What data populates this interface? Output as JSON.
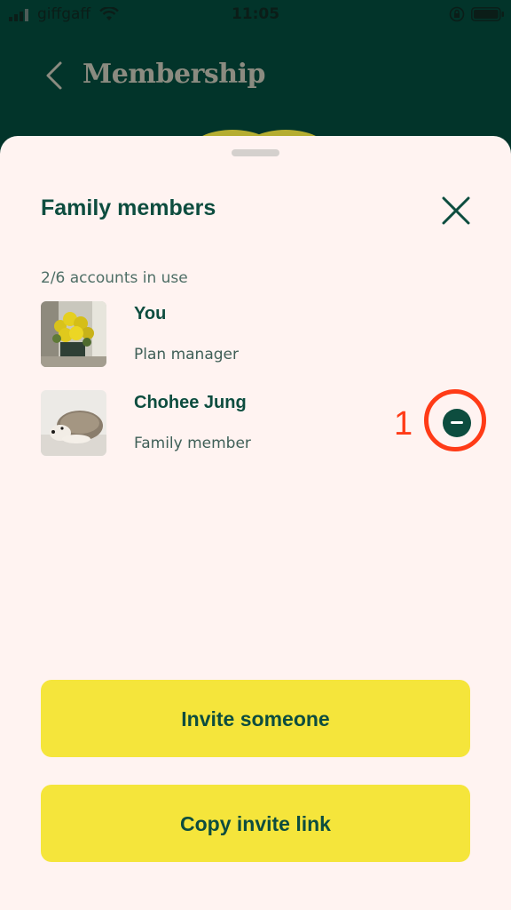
{
  "status_bar": {
    "carrier": "giffgaff",
    "time": "11:05"
  },
  "header": {
    "title": "Membership"
  },
  "sheet": {
    "title": "Family members",
    "accounts_in_use": "2/6 accounts in use",
    "members": [
      {
        "name": "You",
        "role": "Plan manager",
        "avatar": "yellow-flowers-photo"
      },
      {
        "name": "Chohee Jung",
        "role": "Family member",
        "avatar": "hedgehog-photo"
      }
    ],
    "annotation_label": "1",
    "invite_label": "Invite someone",
    "copy_link_label": "Copy invite link"
  },
  "colors": {
    "header_bg": "#02342a",
    "sheet_bg": "#fff3f1",
    "primary_text": "#0d4d3f",
    "button_bg": "#f5e53b",
    "annotation": "#ff3b17"
  }
}
